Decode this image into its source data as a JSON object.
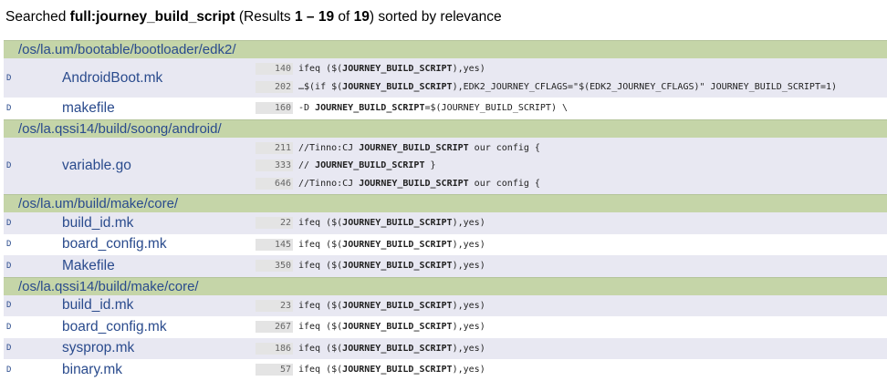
{
  "summary": {
    "prefix": "Searched ",
    "query": "full:journey_build_script",
    "mid1": " (Results ",
    "range": "1 – 19",
    "mid2": " of ",
    "total": "19",
    "suffix": ") sorted by relevance"
  },
  "doc_icon_label": "D",
  "colors": {
    "link": "#2a4b8d",
    "dir_bg": "#c5d5a8",
    "alt_row": "#e8e8f2"
  },
  "groups": [
    {
      "dir": "/os/la.um/bootable/bootloader/edk2/",
      "files": [
        {
          "name": "AndroidBoot.mk",
          "lines": [
            {
              "num": "140",
              "pre": "ifeq ($(",
              "hl": "JOURNEY_BUILD_SCRIPT",
              "post": "),yes)"
            },
            {
              "num": "202",
              "pre": "…$(if $(",
              "hl": "JOURNEY_BUILD_SCRIPT",
              "post": "),EDK2_JOURNEY_CFLAGS=\"$(EDK2_JOURNEY_CFLAGS)\" JOURNEY_BUILD_SCRIPT=1)"
            }
          ]
        },
        {
          "name": "makefile",
          "lines": [
            {
              "num": "160",
              "pre": "-D ",
              "hl": "JOURNEY_BUILD_SCRIPT",
              "post": "=$(JOURNEY_BUILD_SCRIPT) \\"
            }
          ]
        }
      ]
    },
    {
      "dir": "/os/la.qssi14/build/soong/android/",
      "files": [
        {
          "name": "variable.go",
          "lines": [
            {
              "num": "211",
              "pre": "//Tinno:CJ ",
              "hl": "JOURNEY_BUILD_SCRIPT",
              "post": " our config {"
            },
            {
              "num": "333",
              "pre": "// ",
              "hl": "JOURNEY_BUILD_SCRIPT",
              "post": " }"
            },
            {
              "num": "646",
              "pre": "//Tinno:CJ ",
              "hl": "JOURNEY_BUILD_SCRIPT",
              "post": " our config {"
            }
          ]
        }
      ]
    },
    {
      "dir": "/os/la.um/build/make/core/",
      "files": [
        {
          "name": "build_id.mk",
          "lines": [
            {
              "num": "22",
              "pre": "ifeq ($(",
              "hl": "JOURNEY_BUILD_SCRIPT",
              "post": "),yes)"
            }
          ]
        },
        {
          "name": "board_config.mk",
          "lines": [
            {
              "num": "145",
              "pre": "ifeq ($(",
              "hl": "JOURNEY_BUILD_SCRIPT",
              "post": "),yes)"
            }
          ]
        },
        {
          "name": "Makefile",
          "lines": [
            {
              "num": "350",
              "pre": "ifeq ($(",
              "hl": "JOURNEY_BUILD_SCRIPT",
              "post": "),yes)"
            }
          ]
        }
      ]
    },
    {
      "dir": "/os/la.qssi14/build/make/core/",
      "files": [
        {
          "name": "build_id.mk",
          "lines": [
            {
              "num": "23",
              "pre": "ifeq ($(",
              "hl": "JOURNEY_BUILD_SCRIPT",
              "post": "),yes)"
            }
          ]
        },
        {
          "name": "board_config.mk",
          "lines": [
            {
              "num": "267",
              "pre": "ifeq ($(",
              "hl": "JOURNEY_BUILD_SCRIPT",
              "post": "),yes)"
            }
          ]
        },
        {
          "name": "sysprop.mk",
          "lines": [
            {
              "num": "186",
              "pre": "ifeq ($(",
              "hl": "JOURNEY_BUILD_SCRIPT",
              "post": "),yes)"
            }
          ]
        },
        {
          "name": "binary.mk",
          "lines": [
            {
              "num": "57",
              "pre": "ifeq ($(",
              "hl": "JOURNEY_BUILD_SCRIPT",
              "post": "),yes)"
            }
          ]
        }
      ]
    }
  ]
}
